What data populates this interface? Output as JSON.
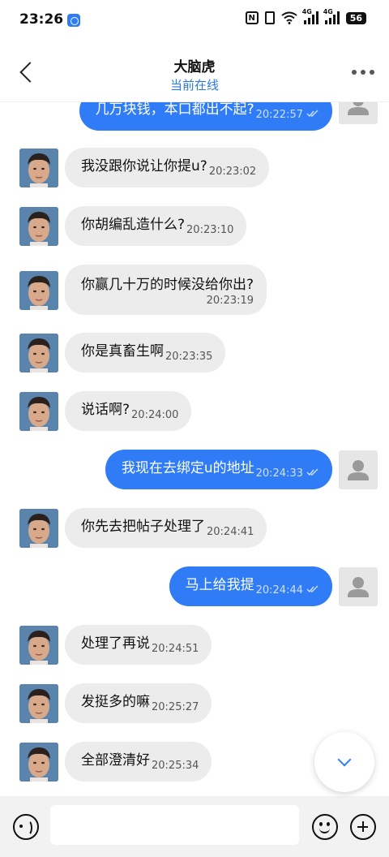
{
  "status_bar": {
    "time": "23:26",
    "signal_tag_1": "4G",
    "signal_tag_2": "4G",
    "battery": "56",
    "nfc": "N"
  },
  "header": {
    "contact_name": "大脑虎",
    "contact_status": "当前在线"
  },
  "messages": [
    {
      "side": "out",
      "text": "几万块钱，本口都出不起?",
      "time": "20:22:57",
      "read": true
    },
    {
      "side": "in",
      "text": "我没跟你说让你提u?",
      "time": "20:23:02"
    },
    {
      "side": "in",
      "text": "你胡编乱造什么?",
      "time": "20:23:10"
    },
    {
      "side": "in",
      "text": "你赢几十万的时候没给你出?",
      "time": "20:23:19"
    },
    {
      "side": "in",
      "text": "你是真畜生啊",
      "time": "20:23:35"
    },
    {
      "side": "in",
      "text": "说话啊?",
      "time": "20:24:00"
    },
    {
      "side": "out",
      "text": "我现在去绑定u的地址",
      "time": "20:24:33",
      "read": true
    },
    {
      "side": "in",
      "text": "你先去把帖子处理了",
      "time": "20:24:41"
    },
    {
      "side": "out",
      "text": "马上给我提",
      "time": "20:24:44",
      "read": true
    },
    {
      "side": "in",
      "text": "处理了再说",
      "time": "20:24:51"
    },
    {
      "side": "in",
      "text": "发挺多的嘛",
      "time": "20:25:27"
    },
    {
      "side": "in",
      "text": "全部澄清好",
      "time": "20:25:34"
    }
  ],
  "input": {
    "placeholder": "",
    "value": ""
  },
  "icons": {
    "back": "back-chevron-icon",
    "more": "more-dots-icon",
    "voice": "voice-icon",
    "emoji": "emoji-icon",
    "plus": "plus-icon",
    "scroll_down": "chevron-down-icon"
  },
  "colors": {
    "accent": "#2f7cf6",
    "status_text": "#2a7ae2",
    "incoming_bubble": "#ececec"
  }
}
